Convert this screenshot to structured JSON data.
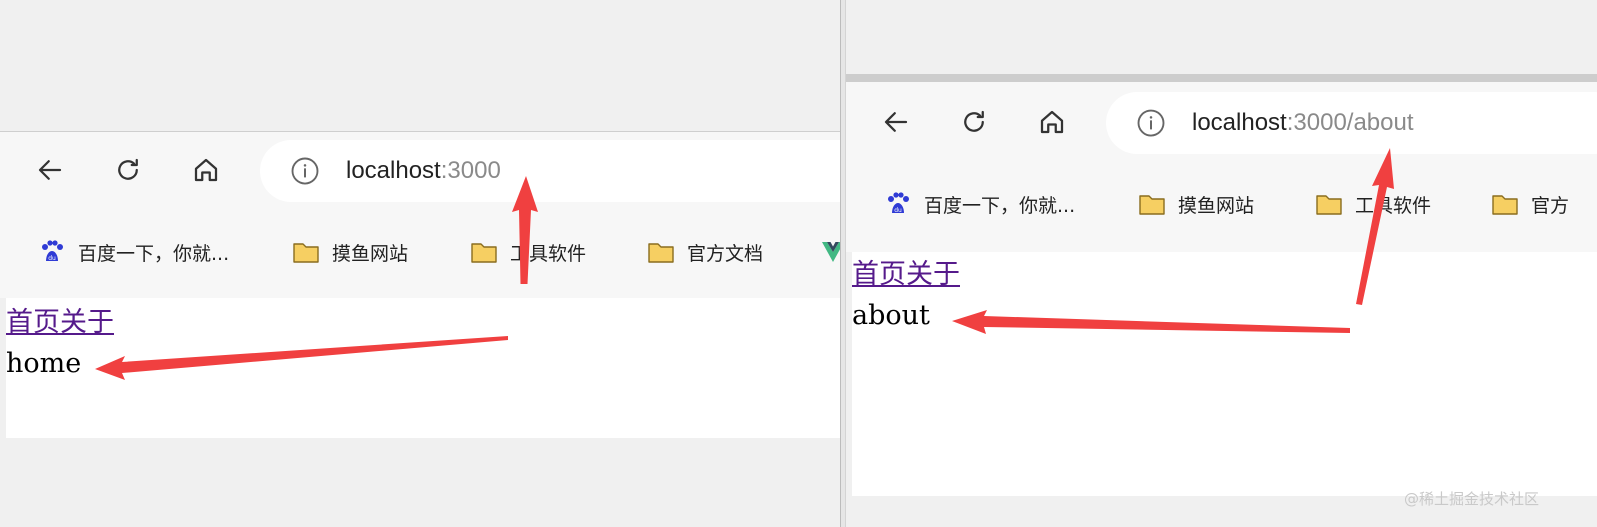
{
  "left": {
    "url_host": "localhost",
    "url_rest": ":3000",
    "bookmarks": [
      {
        "label": "百度一下，你就...",
        "icon": "baidu-icon"
      },
      {
        "label": "摸鱼网站",
        "icon": "folder-icon"
      },
      {
        "label": "工具软件",
        "icon": "folder-icon"
      },
      {
        "label": "官方文档",
        "icon": "folder-icon"
      }
    ],
    "links": [
      "首页",
      "关于"
    ],
    "route_text": "home"
  },
  "right": {
    "url_host": "localhost",
    "url_rest": ":3000/about",
    "bookmarks": [
      {
        "label": "百度一下，你就...",
        "icon": "baidu-icon"
      },
      {
        "label": "摸鱼网站",
        "icon": "folder-icon"
      },
      {
        "label": "工具软件",
        "icon": "folder-icon"
      },
      {
        "label": "官方",
        "icon": "folder-icon"
      }
    ],
    "links": [
      "首页",
      "关于"
    ],
    "route_text": "about"
  },
  "watermark": "@稀土掘金技术社区",
  "colors": {
    "arrow": "#f04040",
    "link": "#551a8b",
    "folder": "#f6cf62",
    "baidu": "#2f3bd5"
  }
}
